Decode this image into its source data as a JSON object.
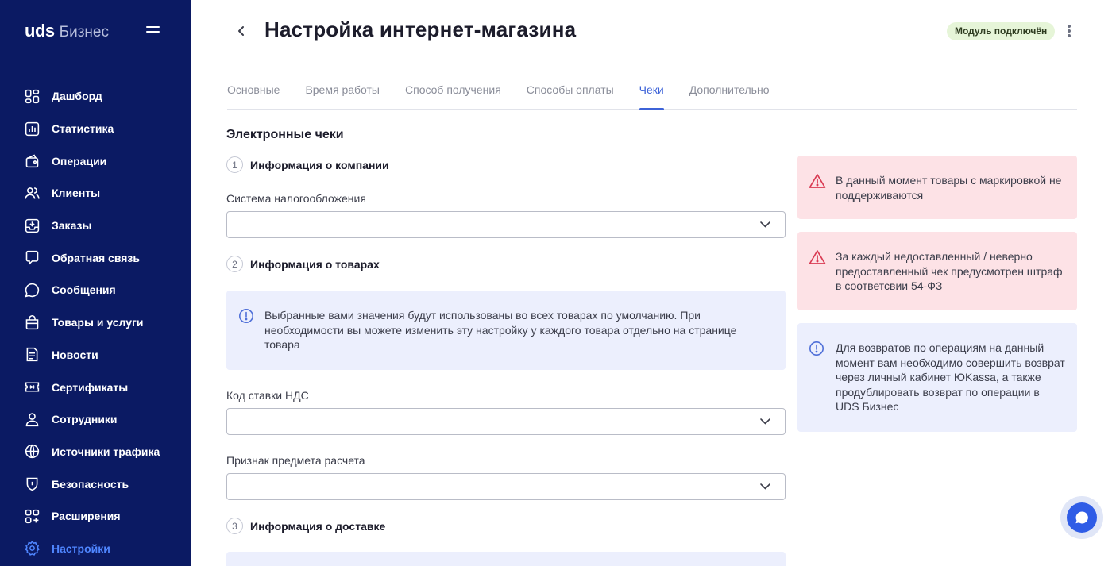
{
  "app": {
    "logo_main": "uds",
    "logo_sub": "Бизнес"
  },
  "sidebar": {
    "items": [
      {
        "label": "Дашборд",
        "icon": "dashboard-icon"
      },
      {
        "label": "Статистика",
        "icon": "chart-icon"
      },
      {
        "label": "Операции",
        "icon": "operations-icon"
      },
      {
        "label": "Клиенты",
        "icon": "clients-icon"
      },
      {
        "label": "Заказы",
        "icon": "orders-icon"
      },
      {
        "label": "Обратная связь",
        "icon": "feedback-icon"
      },
      {
        "label": "Сообщения",
        "icon": "messages-icon"
      },
      {
        "label": "Товары и услуги",
        "icon": "bag-icon"
      },
      {
        "label": "Новости",
        "icon": "news-icon"
      },
      {
        "label": "Сертификаты",
        "icon": "certificate-icon"
      },
      {
        "label": "Сотрудники",
        "icon": "employee-icon"
      },
      {
        "label": "Источники трафика",
        "icon": "globe-icon"
      },
      {
        "label": "Безопасность",
        "icon": "shield-icon"
      },
      {
        "label": "Расширения",
        "icon": "extensions-icon"
      },
      {
        "label": "Настройки",
        "icon": "gear-icon",
        "active": true
      }
    ]
  },
  "header": {
    "title": "Настройка интернет-магазина",
    "status_badge": "Модуль подключён"
  },
  "tabs": [
    {
      "label": "Основные"
    },
    {
      "label": "Время работы"
    },
    {
      "label": "Способ получения"
    },
    {
      "label": "Способы оплаты"
    },
    {
      "label": "Чеки",
      "active": true
    },
    {
      "label": "Дополнительно"
    }
  ],
  "form": {
    "section_title": "Электронные чеки",
    "step1": {
      "num": "1",
      "title": "Информация о компании"
    },
    "tax_system": {
      "label": "Система налогообложения",
      "value": ""
    },
    "step2": {
      "num": "2",
      "title": "Информация о товарах"
    },
    "products_info": "Выбранные вами значения будут использованы во всех товарах по умолчанию. При необходимости вы можете изменить эту настройку у каждого товара отдельно на странице товара",
    "vat_code": {
      "label": "Код ставки НДС",
      "value": ""
    },
    "payment_subject": {
      "label": "Признак предмета расчета",
      "value": ""
    },
    "step3": {
      "num": "3",
      "title": "Информация о доставке"
    }
  },
  "alerts": [
    {
      "type": "warning",
      "text": "В данный момент товары с маркировкой не поддерживаются"
    },
    {
      "type": "warning",
      "text": "За каждый недоставленный / неверно предоставленный чек предусмотрен штраф в соответсвии 54-ФЗ"
    },
    {
      "type": "info",
      "text": "Для возвратов по операциям на данный момент вам необходимо совершить возврат через личный кабинет ЮKassa, а также продублировать возврат по операции в UDS Бизнес"
    }
  ],
  "colors": {
    "sidebar_bg": "#0b1a63",
    "accent": "#3d63d8",
    "warning_bg": "#fde2e6",
    "info_bg": "#eceffd",
    "badge_bg": "#e6f5d8"
  }
}
